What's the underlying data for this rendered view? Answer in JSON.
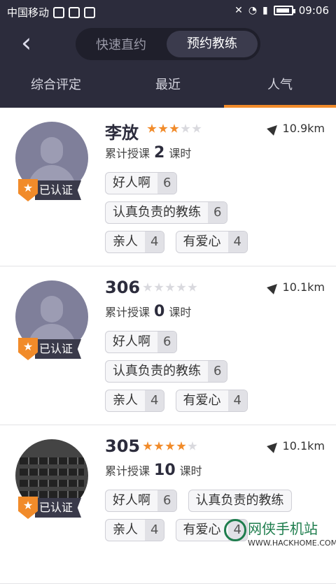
{
  "status_bar": {
    "carrier": "中国移动",
    "time": "09:06"
  },
  "header": {
    "back_label": "‹",
    "segments": [
      {
        "label": "快速直约"
      },
      {
        "label": "预约教练"
      }
    ]
  },
  "tabs": [
    {
      "label": "综合评定"
    },
    {
      "label": "最近"
    },
    {
      "label": "人气"
    }
  ],
  "coaches": [
    {
      "name": "李放",
      "rating": 3,
      "distance": "10.9km",
      "hours_prefix": "累计授课",
      "hours": "2",
      "hours_suffix": "课时",
      "verified_label": "已认证",
      "tags": [
        {
          "label": "好人啊",
          "count": "6"
        },
        {
          "label": "认真负责的教练",
          "count": "6"
        },
        {
          "label": "亲人",
          "count": "4"
        },
        {
          "label": "有爱心",
          "count": "4"
        }
      ]
    },
    {
      "name": "306",
      "rating": 0,
      "distance": "10.1km",
      "hours_prefix": "累计授课",
      "hours": "0",
      "hours_suffix": "课时",
      "verified_label": "已认证",
      "tags": [
        {
          "label": "好人啊",
          "count": "6"
        },
        {
          "label": "认真负责的教练",
          "count": "6"
        },
        {
          "label": "亲人",
          "count": "4"
        },
        {
          "label": "有爱心",
          "count": "4"
        }
      ]
    },
    {
      "name": "305",
      "rating": 4,
      "distance": "10.1km",
      "hours_prefix": "累计授课",
      "hours": "10",
      "hours_suffix": "课时",
      "verified_label": "已认证",
      "tags": [
        {
          "label": "好人啊",
          "count": "6"
        },
        {
          "label": "认真负责的教练",
          "count": ""
        },
        {
          "label": "亲人",
          "count": "4"
        },
        {
          "label": "有爱心",
          "count": "4"
        }
      ]
    }
  ],
  "watermark": {
    "title": "网侠手机站",
    "subtitle": "WWW.HACKHOME.COM"
  },
  "colors": {
    "accent": "#f18b2a",
    "header_bg": "#2c2c3c"
  }
}
